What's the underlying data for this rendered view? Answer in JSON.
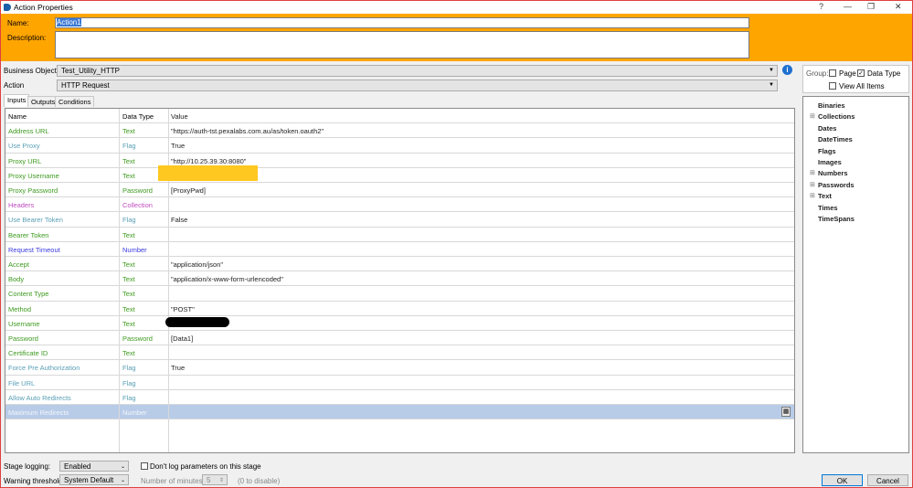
{
  "window": {
    "title": "Action Properties",
    "help": "?",
    "minimize": "—",
    "restore": "❐",
    "close": "✕"
  },
  "header": {
    "name_label": "Name:",
    "name_value": "Action1",
    "description_label": "Description:",
    "description_value": ""
  },
  "business_object": {
    "label": "Business Object",
    "value": "Test_Utility_HTTP"
  },
  "action": {
    "label": "Action",
    "value": "HTTP Request"
  },
  "tabs": [
    {
      "label": "Inputs"
    },
    {
      "label": "Outputs"
    },
    {
      "label": "Conditions"
    }
  ],
  "grid": {
    "headers": [
      "Name",
      "Data Type",
      "Value"
    ],
    "rows": [
      {
        "name": "Address URL",
        "type": "Text",
        "value": "\"https://auth-tst.pexalabs.com.au/as/token.oauth2\""
      },
      {
        "name": "Use Proxy",
        "type": "Flag",
        "value": "True"
      },
      {
        "name": "Proxy URL",
        "type": "Text",
        "value": "\"http://10.25.39.30:8080\""
      },
      {
        "name": "Proxy Username",
        "type": "Text",
        "value": ""
      },
      {
        "name": "Proxy Password",
        "type": "Password",
        "value": "[ProxyPwd]"
      },
      {
        "name": "Headers",
        "type": "Collection",
        "value": ""
      },
      {
        "name": "Use Bearer Token",
        "type": "Flag",
        "value": "False"
      },
      {
        "name": "Bearer Token",
        "type": "Text",
        "value": ""
      },
      {
        "name": "Request Timeout",
        "type": "Number",
        "value": ""
      },
      {
        "name": "Accept",
        "type": "Text",
        "value": "\"application/json\""
      },
      {
        "name": "Body",
        "type": "Text",
        "value": "\"application/x-www-form-urlencoded\""
      },
      {
        "name": "Content Type",
        "type": "Text",
        "value": ""
      },
      {
        "name": "Method",
        "type": "Text",
        "value": "\"POST\""
      },
      {
        "name": "Username",
        "type": "Text",
        "value": ""
      },
      {
        "name": "Password",
        "type": "Password",
        "value": "[Data1]"
      },
      {
        "name": "Certificate ID",
        "type": "Text",
        "value": ""
      },
      {
        "name": "Force Pre Authorization",
        "type": "Flag",
        "value": "True"
      },
      {
        "name": "File URL",
        "type": "Flag",
        "value": ""
      },
      {
        "name": "Allow Auto Redirects",
        "type": "Flag",
        "value": ""
      },
      {
        "name": "Maximum Redirects",
        "type": "Number",
        "value": ""
      }
    ]
  },
  "type_colors": {
    "Text": "#3d9a1f",
    "Password": "#3d9a1f",
    "Flag": "#5a9fb5",
    "Collection": "#c04cc0",
    "Number": "#3a3ae0"
  },
  "group": {
    "label": "Group:",
    "page": "Page",
    "page_checked": false,
    "data_type": "Data Type",
    "data_type_checked": true,
    "view_all": "View All Items",
    "view_all_checked": false
  },
  "tree": [
    {
      "label": "Binaries",
      "expandable": false
    },
    {
      "label": "Collections",
      "expandable": true
    },
    {
      "label": "Dates",
      "expandable": false
    },
    {
      "label": "DateTimes",
      "expandable": false
    },
    {
      "label": "Flags",
      "expandable": false
    },
    {
      "label": "Images",
      "expandable": false
    },
    {
      "label": "Numbers",
      "expandable": true
    },
    {
      "label": "Passwords",
      "expandable": true
    },
    {
      "label": "Text",
      "expandable": true
    },
    {
      "label": "Times",
      "expandable": false
    },
    {
      "label": "TimeSpans",
      "expandable": false
    }
  ],
  "footer": {
    "stage_logging_label": "Stage logging:",
    "stage_logging_value": "Enabled",
    "dont_log_label": "Don't log parameters on this stage",
    "warning_label": "Warning threshold:",
    "warning_value": "System Default",
    "minutes_label": "Number of minutes",
    "minutes_value": "5",
    "disable_hint": "(0 to disable)",
    "ok": "OK",
    "cancel": "Cancel"
  }
}
